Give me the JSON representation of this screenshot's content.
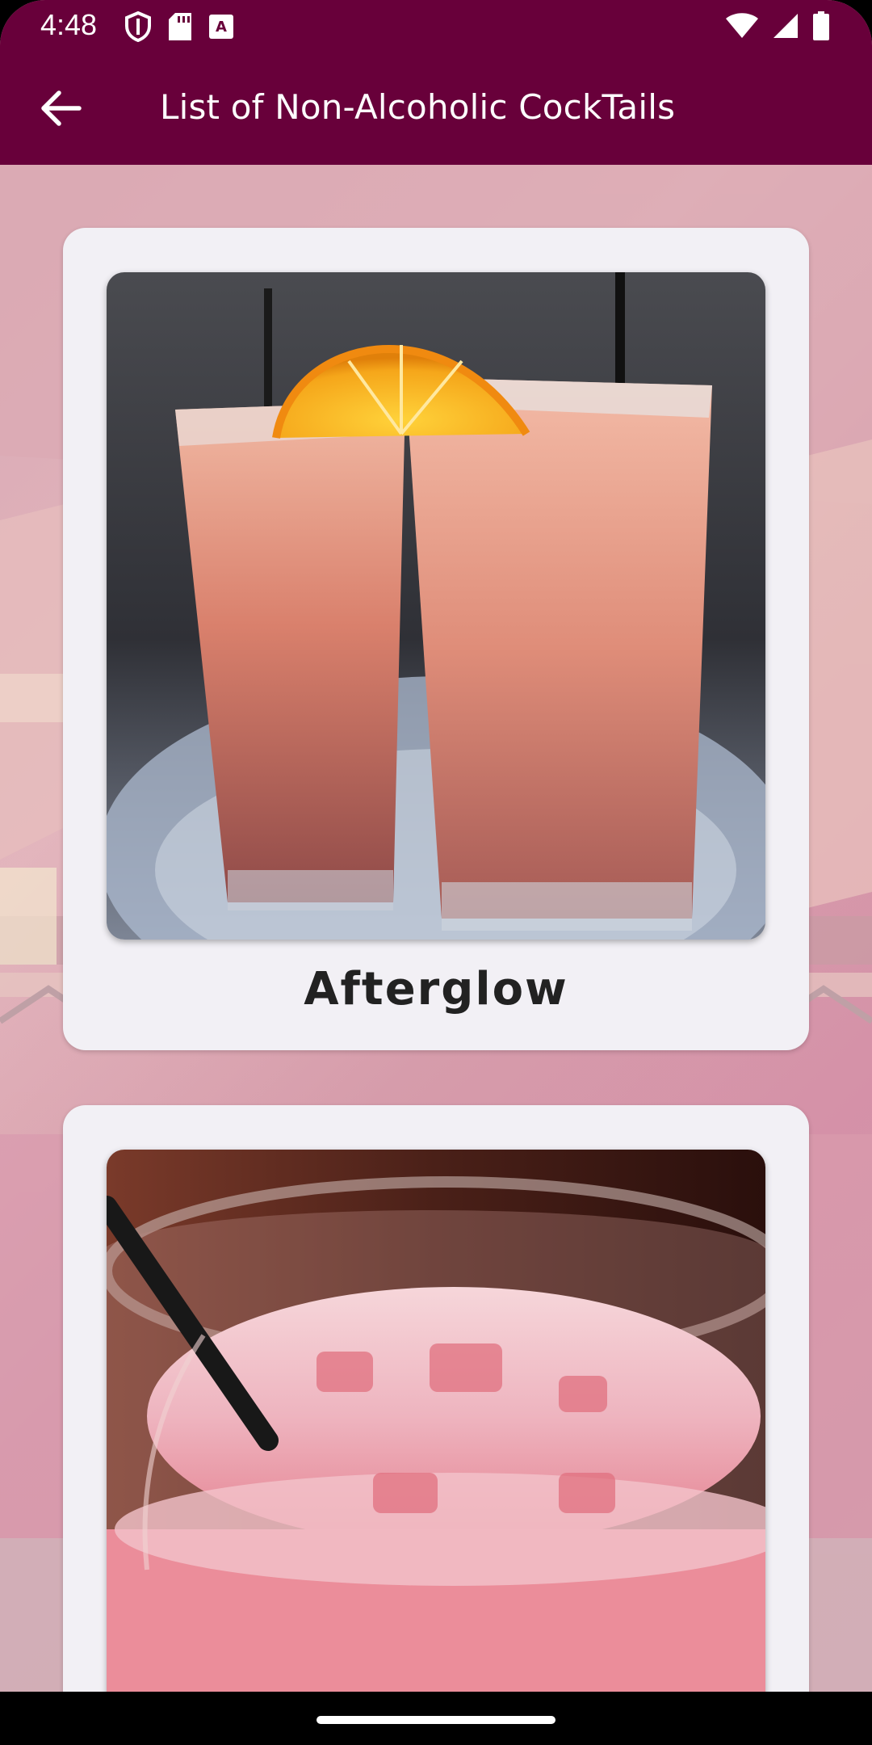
{
  "status_bar": {
    "time": "4:48",
    "left_icons": [
      "shield-icon",
      "sd-card-icon",
      "text-a-icon"
    ],
    "right_icons": [
      "wifi-icon",
      "cell-signal-icon",
      "battery-icon"
    ]
  },
  "app_bar": {
    "title": "List of Non-Alcoholic CockTails",
    "back_icon": "arrow-back-icon"
  },
  "colors": {
    "primary": "#68003a",
    "card": "#f2f0f5",
    "background": "#d9aab5"
  },
  "drinks": [
    {
      "name": "Afterglow"
    },
    {
      "name": ""
    }
  ]
}
